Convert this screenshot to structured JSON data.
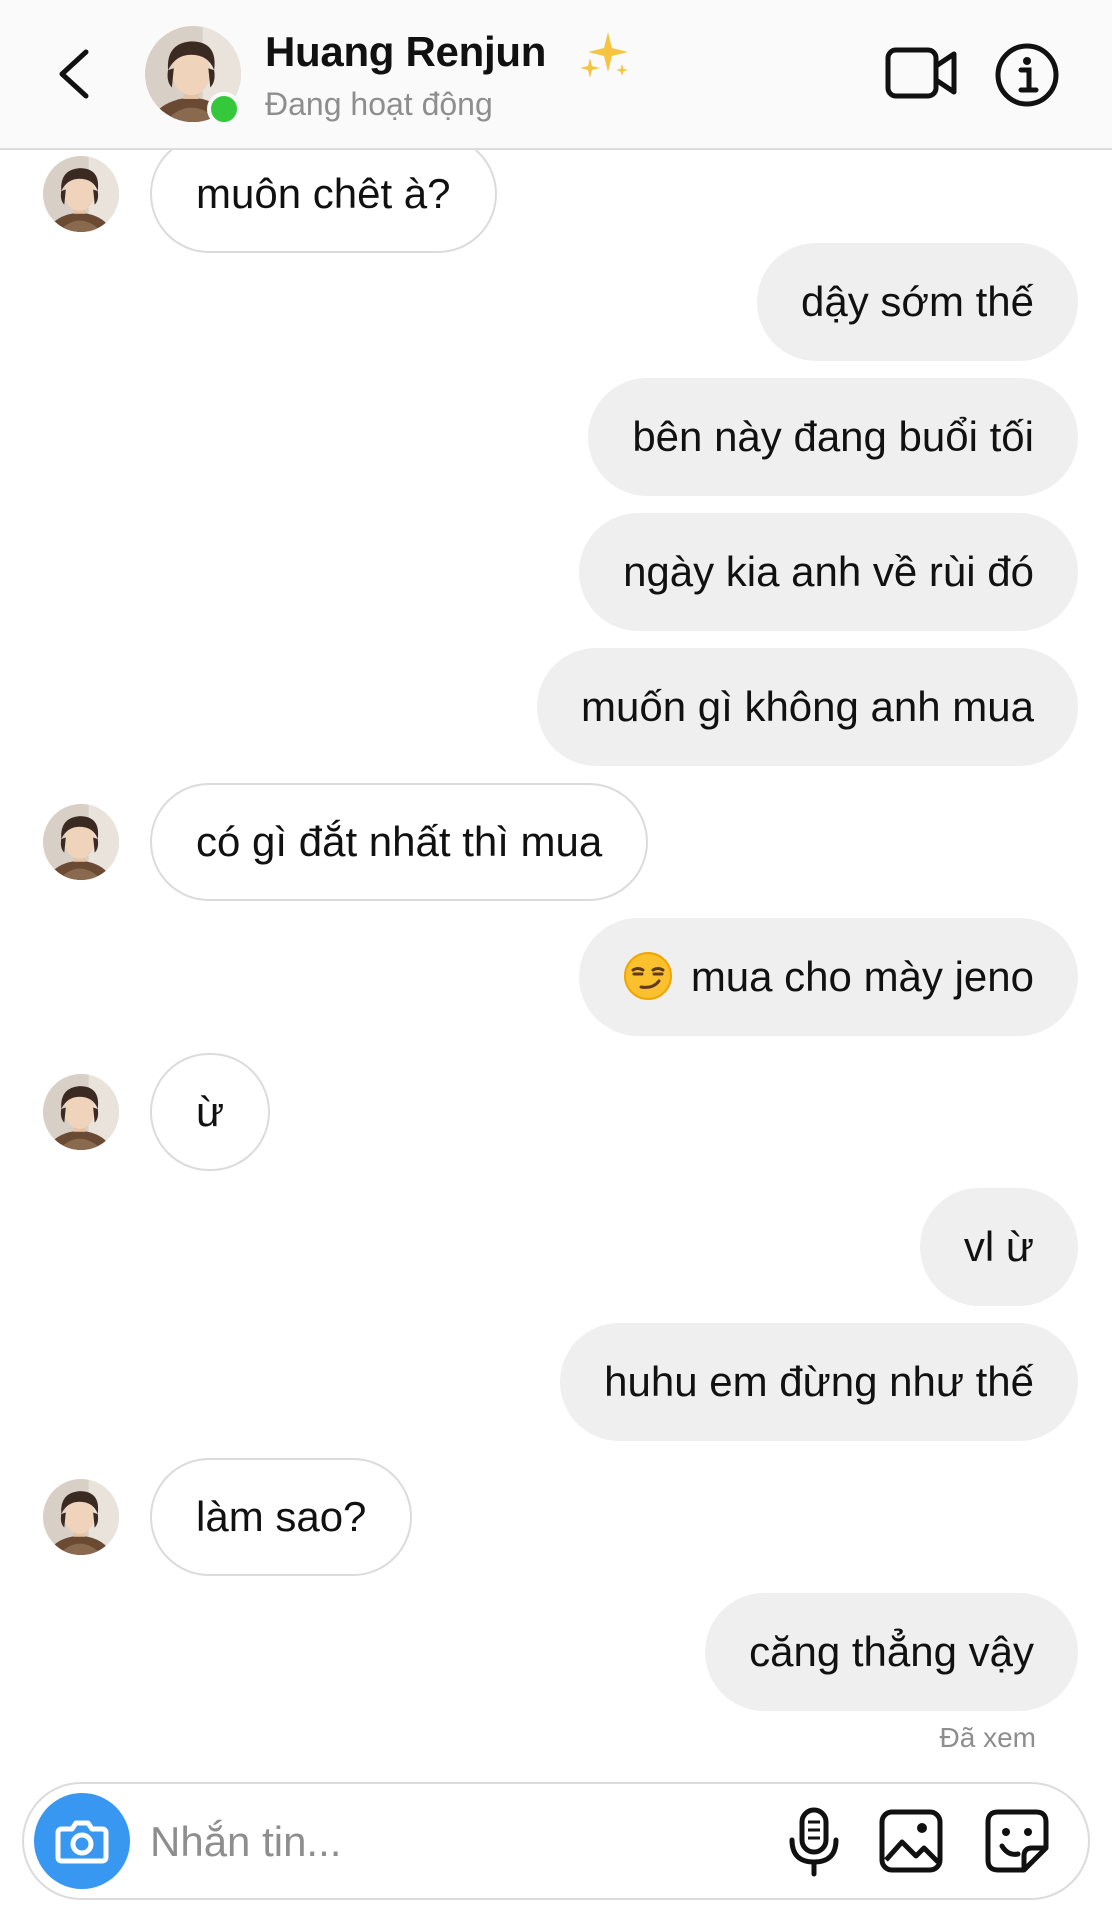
{
  "header": {
    "back_icon": "chevron-left-icon",
    "contact_name": "Huang Renjun",
    "name_emoji": "sparkles-icon",
    "status": "Đang hoạt động",
    "online": true,
    "video_icon": "video-camera-icon",
    "info_icon": "info-icon"
  },
  "messages": [
    {
      "side": "received",
      "text": "muôn chêt à?"
    },
    {
      "side": "sent",
      "text": "dậy sớm thế"
    },
    {
      "side": "sent",
      "text": "bên này đang buổi tối"
    },
    {
      "side": "sent",
      "text": "ngày kia anh về rùi đó"
    },
    {
      "side": "sent",
      "text": "muốn gì không anh mua"
    },
    {
      "side": "received",
      "text": "có gì đắt nhất thì mua"
    },
    {
      "side": "sent",
      "text": "mua cho mày jeno",
      "emoji": "smirking-face-icon"
    },
    {
      "side": "received",
      "text": "ừ"
    },
    {
      "side": "sent",
      "text": "vl ừ"
    },
    {
      "side": "sent",
      "text": "huhu em đừng như thế"
    },
    {
      "side": "received",
      "text": "làm sao?"
    },
    {
      "side": "sent",
      "text": "căng thẳng vậy"
    }
  ],
  "seen_label": "Đã xem",
  "composer": {
    "placeholder": "Nhắn tin...",
    "value": "",
    "camera_icon": "camera-icon",
    "mic_icon": "microphone-icon",
    "gallery_icon": "image-icon",
    "sticker_icon": "sticker-icon"
  },
  "colors": {
    "sent_bubble": "#efefef",
    "received_bubble": "#ffffff",
    "online": "#35c83a",
    "camera_button": "#3897f0",
    "secondary_text": "#8e8e8e"
  }
}
